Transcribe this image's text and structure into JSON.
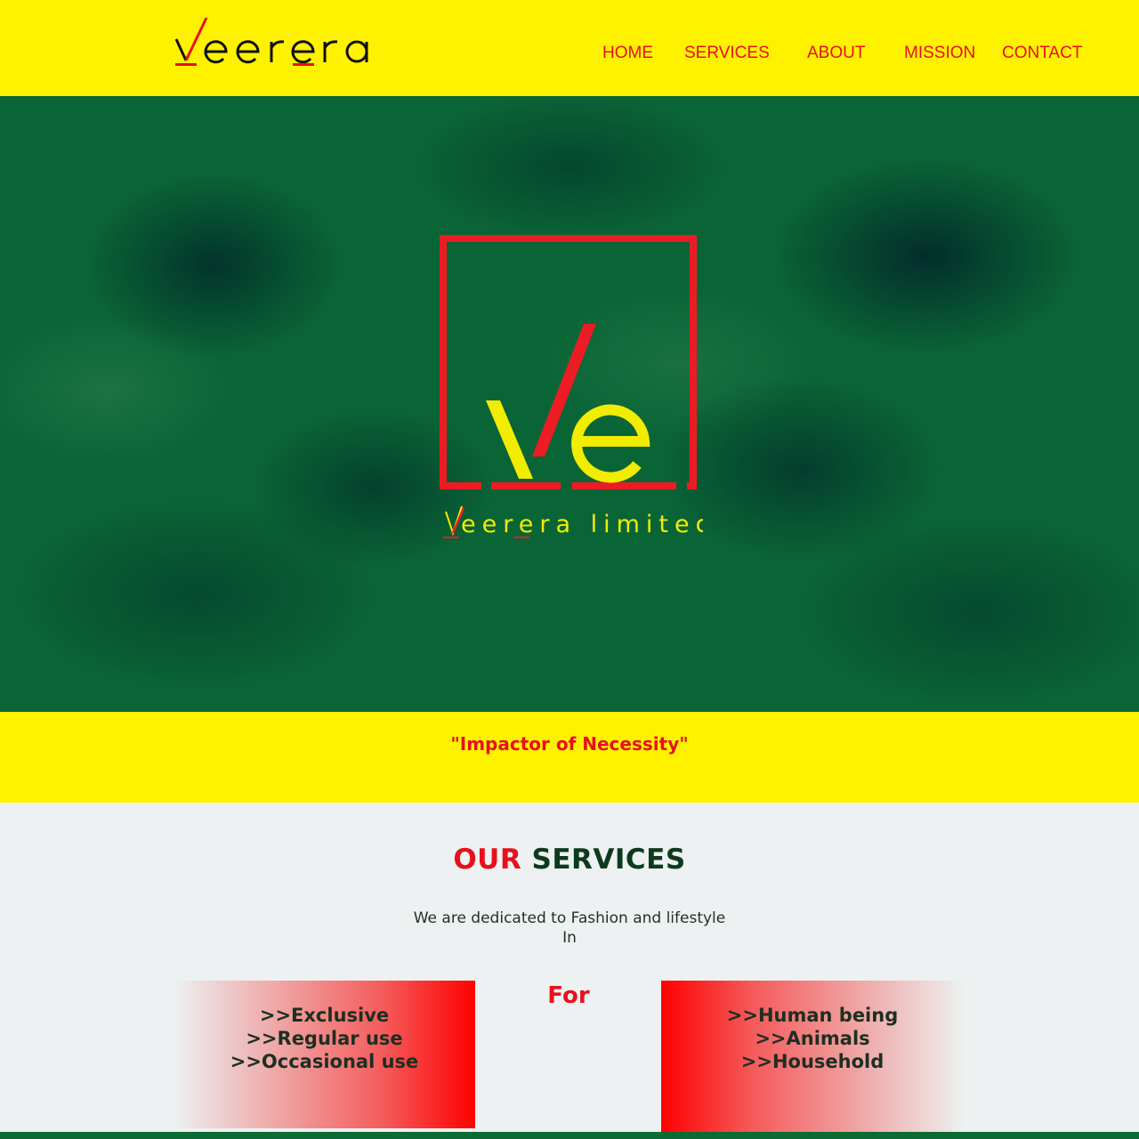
{
  "header": {
    "logo_text": "veerera",
    "nav": [
      {
        "label": "HOME"
      },
      {
        "label": "SERVICES"
      },
      {
        "label": "ABOUT"
      },
      {
        "label": "MISSION"
      },
      {
        "label": "CONTACT"
      }
    ]
  },
  "hero": {
    "emblem_letters": "Ve",
    "emblem_caption": "veerera limited"
  },
  "tagline": "\"Impactor of Necessity\"",
  "services": {
    "title_part1": "OUR",
    "title_part2": "SERVICES",
    "desc_line1": "We are dedicated to Fashion and lifestyle",
    "desc_line2": "In",
    "for_label": "For",
    "left_items": [
      ">>Exclusive",
      ">>Regular use",
      ">>Occasional use"
    ],
    "right_items": [
      ">>Human being",
      ">>Animals",
      ">>Household"
    ]
  },
  "colors": {
    "brand_yellow": "#fff200",
    "brand_red": "#e8101b",
    "hero_green": "#0a6536",
    "dark_green": "#0e3a1c",
    "page_bg": "#edf1f1"
  }
}
